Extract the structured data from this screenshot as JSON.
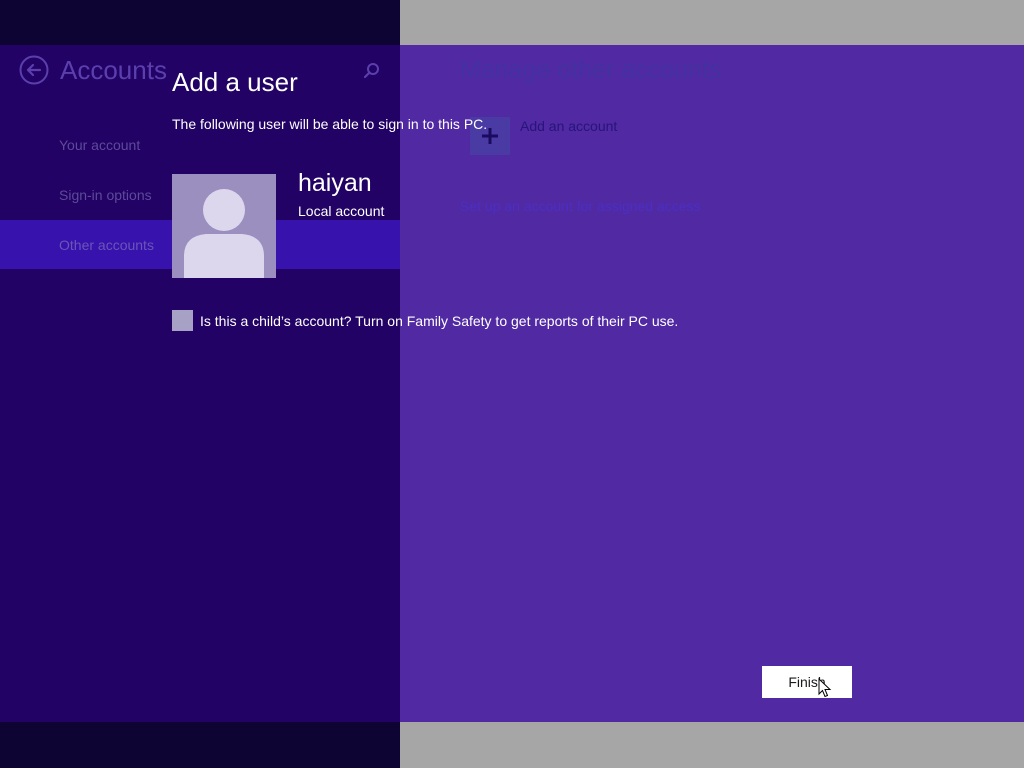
{
  "settings": {
    "title": "Accounts",
    "nav": [
      {
        "label": "Your account"
      },
      {
        "label": "Sign-in options"
      },
      {
        "label": "Other accounts"
      }
    ],
    "manage_title": "Manage other accounts",
    "add_account_label": "Add an account",
    "assigned_access_link": "Set up an account for assigned access"
  },
  "dialog": {
    "title": "Add a user",
    "subtitle": "The following user will be able to sign in to this PC.",
    "user": {
      "name": "haiyan",
      "type": "Local account"
    },
    "child_checkbox": {
      "checked": false,
      "label": "Is this a child’s account? Turn on Family Safety to get reports of their PC use."
    },
    "finish_label": "Finish"
  },
  "colors": {
    "dialog_band": "#4a1fa3",
    "dialog_left": "#1f0060",
    "selected_nav": "#3b15b8",
    "button_bg": "#ffffff",
    "text": "#ffffff"
  },
  "icons": {
    "back": "back-arrow-circle-icon",
    "search": "search-icon",
    "add": "plus-icon",
    "avatar": "user-silhouette-icon",
    "cursor": "mouse-pointer-icon"
  }
}
